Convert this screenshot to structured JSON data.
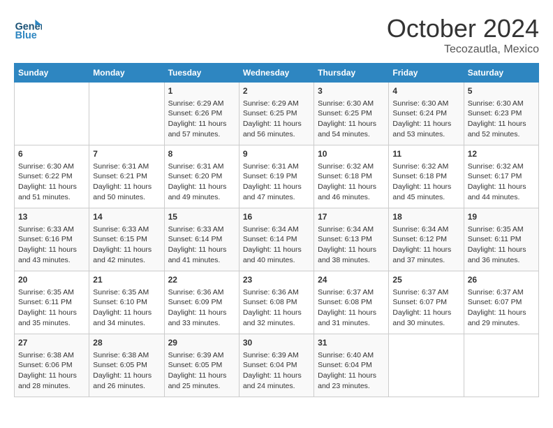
{
  "header": {
    "logo_general": "General",
    "logo_blue": "Blue",
    "month": "October 2024",
    "location": "Tecozautla, Mexico"
  },
  "days_of_week": [
    "Sunday",
    "Monday",
    "Tuesday",
    "Wednesday",
    "Thursday",
    "Friday",
    "Saturday"
  ],
  "weeks": [
    [
      {
        "day": "",
        "sunrise": "",
        "sunset": "",
        "daylight": ""
      },
      {
        "day": "",
        "sunrise": "",
        "sunset": "",
        "daylight": ""
      },
      {
        "day": "1",
        "sunrise": "Sunrise: 6:29 AM",
        "sunset": "Sunset: 6:26 PM",
        "daylight": "Daylight: 11 hours and 57 minutes."
      },
      {
        "day": "2",
        "sunrise": "Sunrise: 6:29 AM",
        "sunset": "Sunset: 6:25 PM",
        "daylight": "Daylight: 11 hours and 56 minutes."
      },
      {
        "day": "3",
        "sunrise": "Sunrise: 6:30 AM",
        "sunset": "Sunset: 6:25 PM",
        "daylight": "Daylight: 11 hours and 54 minutes."
      },
      {
        "day": "4",
        "sunrise": "Sunrise: 6:30 AM",
        "sunset": "Sunset: 6:24 PM",
        "daylight": "Daylight: 11 hours and 53 minutes."
      },
      {
        "day": "5",
        "sunrise": "Sunrise: 6:30 AM",
        "sunset": "Sunset: 6:23 PM",
        "daylight": "Daylight: 11 hours and 52 minutes."
      }
    ],
    [
      {
        "day": "6",
        "sunrise": "Sunrise: 6:30 AM",
        "sunset": "Sunset: 6:22 PM",
        "daylight": "Daylight: 11 hours and 51 minutes."
      },
      {
        "day": "7",
        "sunrise": "Sunrise: 6:31 AM",
        "sunset": "Sunset: 6:21 PM",
        "daylight": "Daylight: 11 hours and 50 minutes."
      },
      {
        "day": "8",
        "sunrise": "Sunrise: 6:31 AM",
        "sunset": "Sunset: 6:20 PM",
        "daylight": "Daylight: 11 hours and 49 minutes."
      },
      {
        "day": "9",
        "sunrise": "Sunrise: 6:31 AM",
        "sunset": "Sunset: 6:19 PM",
        "daylight": "Daylight: 11 hours and 47 minutes."
      },
      {
        "day": "10",
        "sunrise": "Sunrise: 6:32 AM",
        "sunset": "Sunset: 6:18 PM",
        "daylight": "Daylight: 11 hours and 46 minutes."
      },
      {
        "day": "11",
        "sunrise": "Sunrise: 6:32 AM",
        "sunset": "Sunset: 6:18 PM",
        "daylight": "Daylight: 11 hours and 45 minutes."
      },
      {
        "day": "12",
        "sunrise": "Sunrise: 6:32 AM",
        "sunset": "Sunset: 6:17 PM",
        "daylight": "Daylight: 11 hours and 44 minutes."
      }
    ],
    [
      {
        "day": "13",
        "sunrise": "Sunrise: 6:33 AM",
        "sunset": "Sunset: 6:16 PM",
        "daylight": "Daylight: 11 hours and 43 minutes."
      },
      {
        "day": "14",
        "sunrise": "Sunrise: 6:33 AM",
        "sunset": "Sunset: 6:15 PM",
        "daylight": "Daylight: 11 hours and 42 minutes."
      },
      {
        "day": "15",
        "sunrise": "Sunrise: 6:33 AM",
        "sunset": "Sunset: 6:14 PM",
        "daylight": "Daylight: 11 hours and 41 minutes."
      },
      {
        "day": "16",
        "sunrise": "Sunrise: 6:34 AM",
        "sunset": "Sunset: 6:14 PM",
        "daylight": "Daylight: 11 hours and 40 minutes."
      },
      {
        "day": "17",
        "sunrise": "Sunrise: 6:34 AM",
        "sunset": "Sunset: 6:13 PM",
        "daylight": "Daylight: 11 hours and 38 minutes."
      },
      {
        "day": "18",
        "sunrise": "Sunrise: 6:34 AM",
        "sunset": "Sunset: 6:12 PM",
        "daylight": "Daylight: 11 hours and 37 minutes."
      },
      {
        "day": "19",
        "sunrise": "Sunrise: 6:35 AM",
        "sunset": "Sunset: 6:11 PM",
        "daylight": "Daylight: 11 hours and 36 minutes."
      }
    ],
    [
      {
        "day": "20",
        "sunrise": "Sunrise: 6:35 AM",
        "sunset": "Sunset: 6:11 PM",
        "daylight": "Daylight: 11 hours and 35 minutes."
      },
      {
        "day": "21",
        "sunrise": "Sunrise: 6:35 AM",
        "sunset": "Sunset: 6:10 PM",
        "daylight": "Daylight: 11 hours and 34 minutes."
      },
      {
        "day": "22",
        "sunrise": "Sunrise: 6:36 AM",
        "sunset": "Sunset: 6:09 PM",
        "daylight": "Daylight: 11 hours and 33 minutes."
      },
      {
        "day": "23",
        "sunrise": "Sunrise: 6:36 AM",
        "sunset": "Sunset: 6:08 PM",
        "daylight": "Daylight: 11 hours and 32 minutes."
      },
      {
        "day": "24",
        "sunrise": "Sunrise: 6:37 AM",
        "sunset": "Sunset: 6:08 PM",
        "daylight": "Daylight: 11 hours and 31 minutes."
      },
      {
        "day": "25",
        "sunrise": "Sunrise: 6:37 AM",
        "sunset": "Sunset: 6:07 PM",
        "daylight": "Daylight: 11 hours and 30 minutes."
      },
      {
        "day": "26",
        "sunrise": "Sunrise: 6:37 AM",
        "sunset": "Sunset: 6:07 PM",
        "daylight": "Daylight: 11 hours and 29 minutes."
      }
    ],
    [
      {
        "day": "27",
        "sunrise": "Sunrise: 6:38 AM",
        "sunset": "Sunset: 6:06 PM",
        "daylight": "Daylight: 11 hours and 28 minutes."
      },
      {
        "day": "28",
        "sunrise": "Sunrise: 6:38 AM",
        "sunset": "Sunset: 6:05 PM",
        "daylight": "Daylight: 11 hours and 26 minutes."
      },
      {
        "day": "29",
        "sunrise": "Sunrise: 6:39 AM",
        "sunset": "Sunset: 6:05 PM",
        "daylight": "Daylight: 11 hours and 25 minutes."
      },
      {
        "day": "30",
        "sunrise": "Sunrise: 6:39 AM",
        "sunset": "Sunset: 6:04 PM",
        "daylight": "Daylight: 11 hours and 24 minutes."
      },
      {
        "day": "31",
        "sunrise": "Sunrise: 6:40 AM",
        "sunset": "Sunset: 6:04 PM",
        "daylight": "Daylight: 11 hours and 23 minutes."
      },
      {
        "day": "",
        "sunrise": "",
        "sunset": "",
        "daylight": ""
      },
      {
        "day": "",
        "sunrise": "",
        "sunset": "",
        "daylight": ""
      }
    ]
  ]
}
